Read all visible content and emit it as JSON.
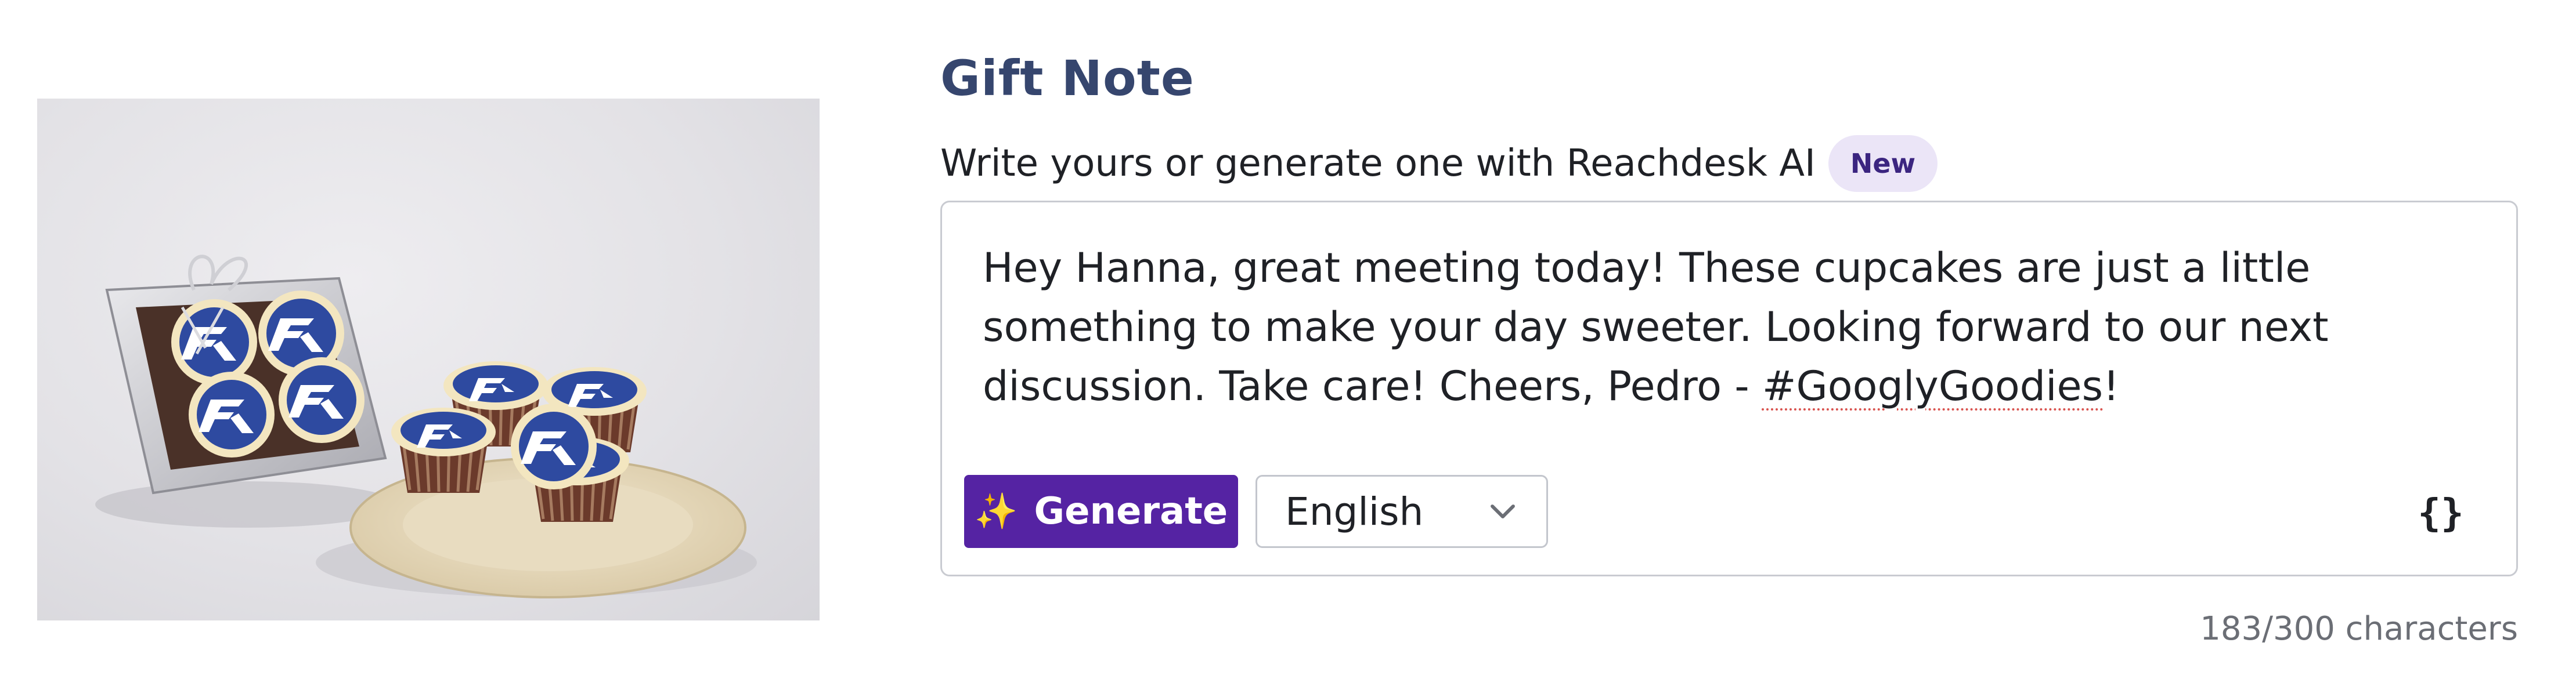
{
  "product": {
    "image_alt": "Cupcakes with Reachdesk logo"
  },
  "gift_note": {
    "title": "Gift Note",
    "subtitle": "Write yours or generate one with Reachdesk AI",
    "badge": "New",
    "message_before_tag": "Hey Hanna, great meeting today! These cupcakes are just a little something to make your day sweeter. Looking forward to our next discussion. Take care! Cheers, Pedro - ",
    "message_tag": "#GooglyGoodies",
    "message_after_tag": "!",
    "generate_label": "Generate",
    "sparkle_icon": "✨",
    "language_selected": "English",
    "variables_icon_text": "{}",
    "character_count": "183/300 characters"
  },
  "colors": {
    "title": "#36466e",
    "generate_button": "#5523a3",
    "badge_bg": "#ebe5f7",
    "badge_text": "#3b2580",
    "logo_blue": "#2e4aa0"
  },
  "icons": {
    "sparkle": "sparkle-icon",
    "chevron": "chevron-down-icon",
    "variables": "curly-braces-icon"
  }
}
